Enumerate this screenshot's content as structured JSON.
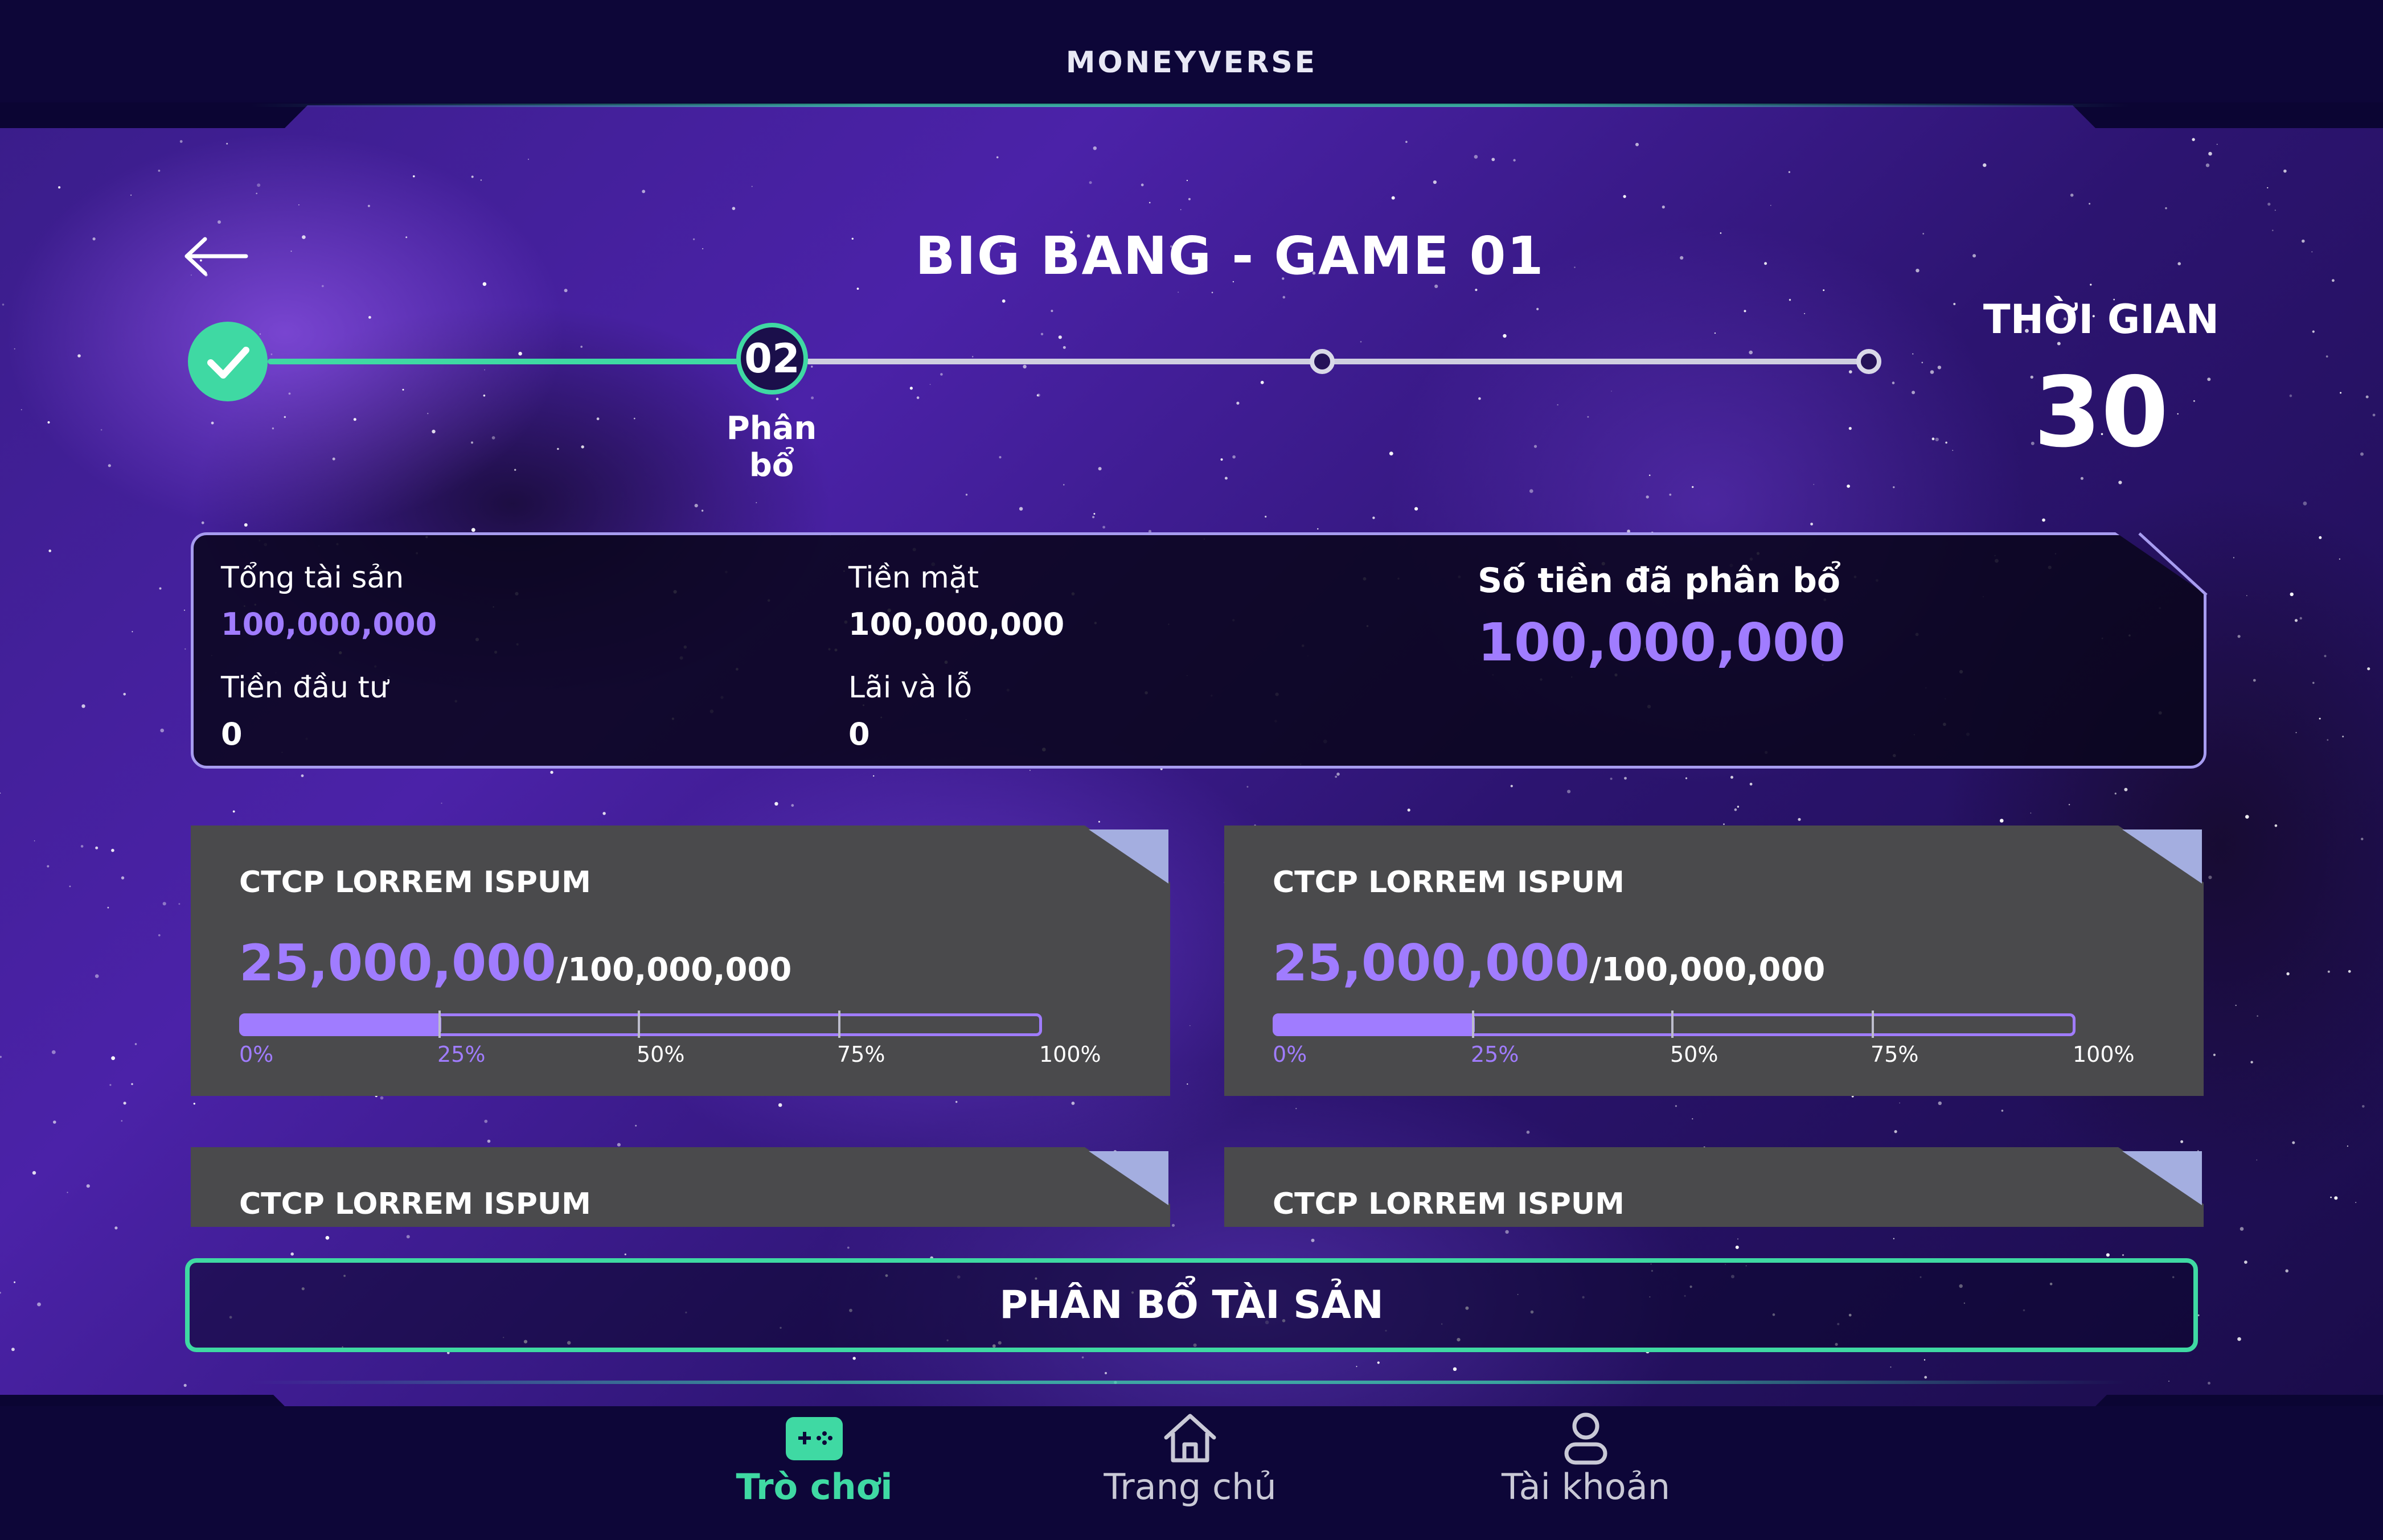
{
  "app": {
    "logo": "MONEYVERSE"
  },
  "header": {
    "title": "BIG BANG - GAME 01"
  },
  "stepper": {
    "current_step": "02",
    "current_label": "Phân bổ",
    "total_steps": 4
  },
  "timer": {
    "label": "THỜI GIAN",
    "value": "30"
  },
  "summary": {
    "total_assets_label": "Tổng tài sản",
    "total_assets_value": "100,000,000",
    "cash_label": "Tiền mặt",
    "cash_value": "100,000,000",
    "invested_label": "Tiền đầu tư",
    "invested_value": "0",
    "pnl_label": "Lãi và lỗ",
    "pnl_value": "0",
    "allocated_label": "Số tiền đã phân bổ",
    "allocated_value": "100,000,000"
  },
  "cards": [
    {
      "title": "CTCP LORREM ISPUM",
      "value": "25,000,000",
      "total": "/100,000,000",
      "progress": 0.25
    },
    {
      "title": "CTCP LORREM ISPUM",
      "value": "25,000,000",
      "total": "/100,000,000",
      "progress": 0.25
    },
    {
      "title": "CTCP LORREM ISPUM"
    },
    {
      "title": "CTCP LORREM ISPUM"
    }
  ],
  "scale": [
    "0%",
    "25%",
    "50%",
    "75%",
    "100%"
  ],
  "cta": {
    "label": "PHÂN BỔ TÀI SẢN"
  },
  "nav": {
    "items": [
      {
        "label": "Trò chơi",
        "icon": "gamepad-icon",
        "active": true
      },
      {
        "label": "Trang chủ",
        "icon": "home-icon",
        "active": false
      },
      {
        "label": "Tài khoản",
        "icon": "user-icon",
        "active": false
      }
    ]
  },
  "colors": {
    "accent": "#3fd9a3",
    "purple": "#a07cff",
    "card": "#4a4a4c",
    "background": "#0b0533"
  }
}
